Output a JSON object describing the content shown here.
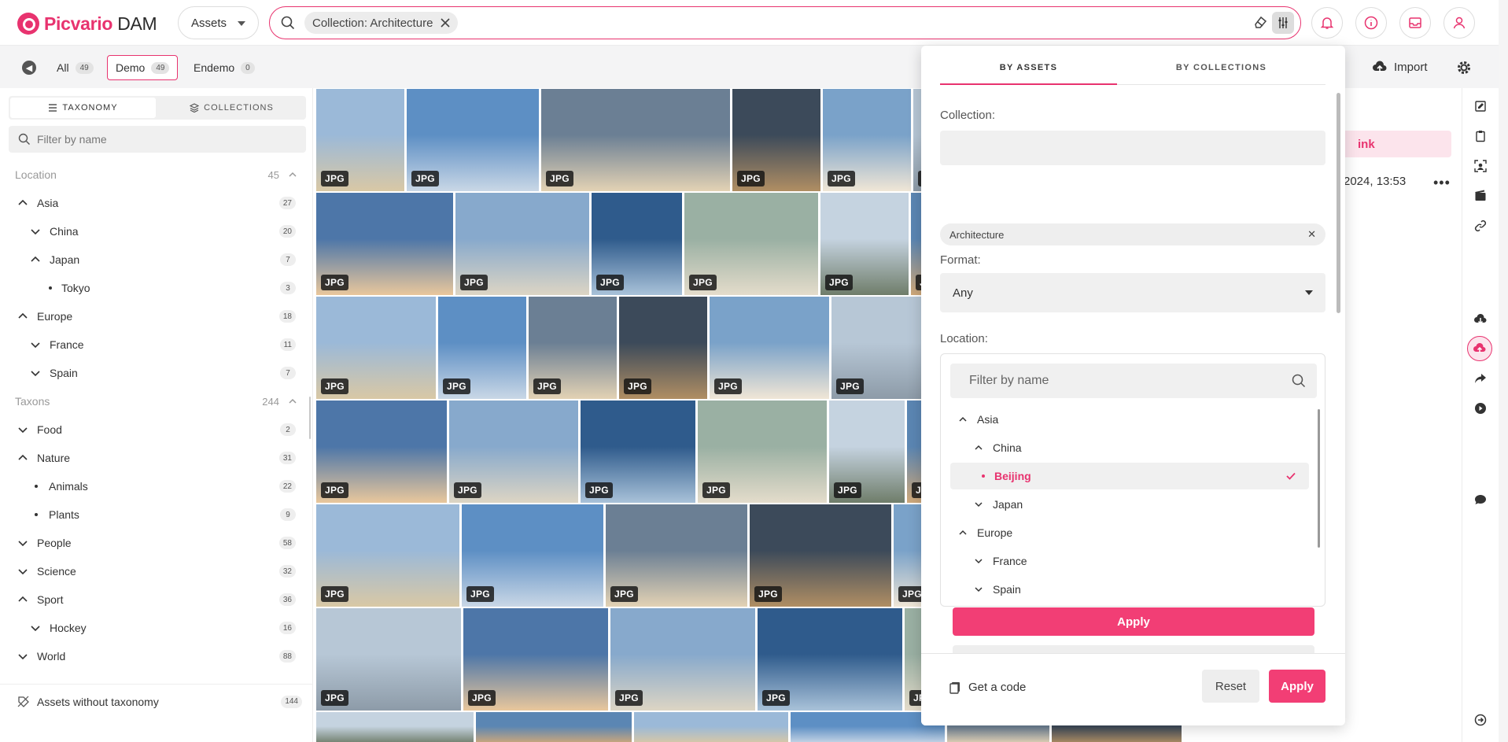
{
  "app": {
    "name_part1": "Picvario",
    "name_part2": "DAM"
  },
  "header": {
    "assets_dropdown": "Assets",
    "search_chip": "Collection: Architecture"
  },
  "subbar": {
    "filters": [
      {
        "label": "All",
        "count": "49"
      },
      {
        "label": "Demo",
        "count": "49"
      },
      {
        "label": "Endemo",
        "count": "0"
      }
    ],
    "import_label": "Import"
  },
  "left": {
    "tabs": {
      "taxonomy": "TAXONOMY",
      "collections": "COLLECTIONS"
    },
    "filter_placeholder": "Filter by name",
    "tree": [
      {
        "label": "Location",
        "count": "45",
        "section": true
      },
      {
        "label": "Asia",
        "count": "27"
      },
      {
        "label": "China",
        "count": "20"
      },
      {
        "label": "Japan",
        "count": "7"
      },
      {
        "label": "Tokyo",
        "count": "3"
      },
      {
        "label": "Europe",
        "count": "18"
      },
      {
        "label": "France",
        "count": "11"
      },
      {
        "label": "Spain",
        "count": "7"
      },
      {
        "label": "Taxons",
        "count": "244",
        "section": true
      },
      {
        "label": "Food",
        "count": "2"
      },
      {
        "label": "Nature",
        "count": "31"
      },
      {
        "label": "Animals",
        "count": "22"
      },
      {
        "label": "Plants",
        "count": "9"
      },
      {
        "label": "People",
        "count": "58"
      },
      {
        "label": "Science",
        "count": "32"
      },
      {
        "label": "Sport",
        "count": "36"
      },
      {
        "label": "Hockey",
        "count": "16"
      },
      {
        "label": "World",
        "count": "88"
      }
    ],
    "footer": {
      "label": "Assets without taxonomy",
      "count": "144"
    }
  },
  "grid": {
    "badge": "JPG"
  },
  "right": {
    "link_label": "ink",
    "date_text": "2024, 13:53"
  },
  "popup": {
    "tabs": {
      "by_assets": "BY ASSETS",
      "by_collections": "BY COLLECTIONS"
    },
    "collection_label": "Collection:",
    "collection_chip": "Architecture",
    "format_label": "Format:",
    "format_value": "Any",
    "location_label": "Location:",
    "location_filter_placeholder": "Filter by name",
    "location_tree": [
      {
        "label": "Asia"
      },
      {
        "label": "China"
      },
      {
        "label": "Beijing"
      },
      {
        "label": "Japan"
      },
      {
        "label": "Europe"
      },
      {
        "label": "France"
      },
      {
        "label": "Spain"
      }
    ],
    "apply_inner": "Apply",
    "get_code": "Get a code",
    "reset": "Reset",
    "apply": "Apply"
  },
  "colors": {
    "accent": "#e8336f",
    "button": "#f23e75"
  }
}
